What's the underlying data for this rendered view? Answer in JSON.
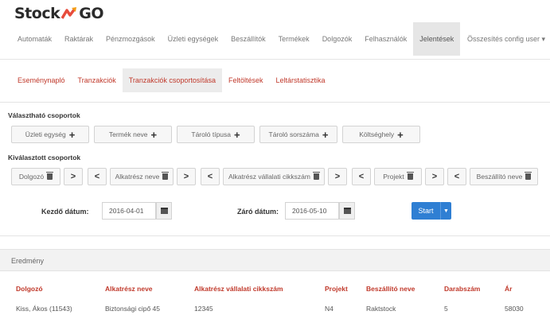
{
  "app": {
    "logo_left": "Stock",
    "logo_right": "GO"
  },
  "nav": {
    "items": [
      "Automaták",
      "Raktárak",
      "Pénzmozgások",
      "Üzleti egységek",
      "Beszállítók",
      "Termékek",
      "Dolgozók",
      "Felhasználók",
      "Jelentések"
    ],
    "active_index": 8,
    "right_item": "Összesítés config user ▾"
  },
  "tabs": {
    "items": [
      "Eseménynapló",
      "Tranzakciók",
      "Tranzakciók csoportosítása",
      "Feltöltések",
      "Leltárstatisztika"
    ],
    "active_index": 2
  },
  "available_groups": {
    "label": "Választható csoportok",
    "buttons": [
      "Üzleti egység",
      "Termék neve",
      "Tároló típusa",
      "Tároló sorszáma",
      "Költséghely"
    ]
  },
  "selected_groups": {
    "label": "Kiválasztott csoportok",
    "items": [
      "Dolgozó",
      "Alkatrész neve",
      "Alkatrész vállalati cikkszám",
      "Projekt",
      "Beszállító neve"
    ]
  },
  "filters": {
    "from_label": "Kezdő dátum:",
    "from_value": "2016-04-01",
    "to_label": "Záró dátum:",
    "to_value": "2016-05-10",
    "start_label": "Start"
  },
  "results": {
    "title": "Eredmény",
    "columns": [
      "Dolgozó",
      "Alkatrész neve",
      "Alkatrész vállalati cikkszám",
      "Projekt",
      "Beszállító neve",
      "Darabszám",
      "Ár"
    ],
    "rows": [
      [
        "Kiss, Ákos (11543)",
        "Biztonsági cipő 45",
        "12345",
        "N4",
        "Raktstock",
        "5",
        "58030"
      ]
    ]
  },
  "colors": {
    "accent": "#c0392b",
    "primary": "#2f7fd3"
  }
}
